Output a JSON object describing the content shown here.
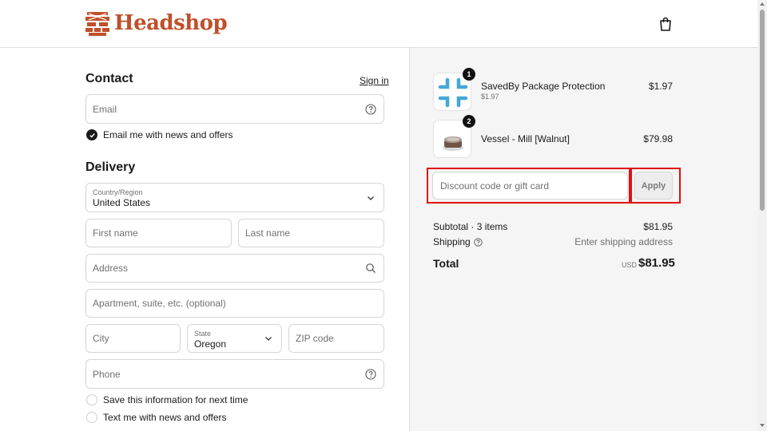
{
  "header": {
    "brand": "Headshop",
    "brand_color": "#c0502a",
    "logo_icon": "brick-wall-logo-icon",
    "cart_icon": "shopping-bag-icon"
  },
  "contact": {
    "title": "Contact",
    "sign_in": "Sign in",
    "email_placeholder": "Email",
    "email_news_label": "Email me with news and offers",
    "email_news_checked": true
  },
  "delivery": {
    "title": "Delivery",
    "country_label": "Country/Region",
    "country_value": "United States",
    "first_name_placeholder": "First name",
    "last_name_placeholder": "Last name",
    "address_placeholder": "Address",
    "apartment_placeholder": "Apartment, suite, etc. (optional)",
    "city_placeholder": "City",
    "state_label": "State",
    "state_value": "Oregon",
    "zip_placeholder": "ZIP code",
    "phone_placeholder": "Phone",
    "save_info_label": "Save this information for next time",
    "text_news_label": "Text me with news and offers"
  },
  "order": {
    "items": [
      {
        "name": "SavedBy Package Protection",
        "sub": "$1.97",
        "price": "$1.97",
        "qty": "1"
      },
      {
        "name": "Vessel - Mill [Walnut]",
        "sub": "",
        "price": "$79.98",
        "qty": "2"
      }
    ],
    "discount_placeholder": "Discount code or gift card",
    "apply_label": "Apply",
    "subtotal_label": "Subtotal · 3 items",
    "subtotal_value": "$81.95",
    "shipping_label": "Shipping",
    "shipping_value": "Enter shipping address",
    "total_label": "Total",
    "total_currency": "USD",
    "total_value": "$81.95"
  },
  "colors": {
    "highlight": "#e01010",
    "accent": "#c0502a",
    "package_icon": "#45a8d6"
  }
}
